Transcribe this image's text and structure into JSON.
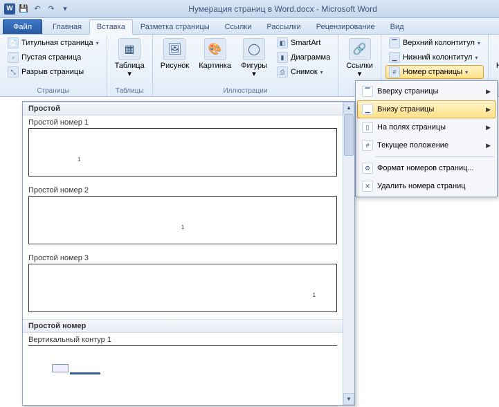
{
  "title": "Нумерация страниц в Word.docx - Microsoft Word",
  "qat": {
    "save": "💾",
    "undo": "↶",
    "redo": "↷"
  },
  "tabs": {
    "file": "Файл",
    "items": [
      "Главная",
      "Вставка",
      "Разметка страницы",
      "Ссылки",
      "Рассылки",
      "Рецензирование",
      "Вид"
    ],
    "active_index": 1
  },
  "ribbon": {
    "pages": {
      "title_page": "Титульная страница",
      "blank_page": "Пустая страница",
      "page_break": "Разрыв страницы",
      "group": "Страницы"
    },
    "tables": {
      "table": "Таблица",
      "group": "Таблицы"
    },
    "illus": {
      "picture": "Рисунок",
      "clipart": "Картинка",
      "shapes": "Фигуры",
      "smartart": "SmartArt",
      "chart": "Диаграмма",
      "screenshot": "Снимок",
      "group": "Иллюстрации"
    },
    "links": {
      "links": "Ссылки",
      "group": ""
    },
    "headerfooter": {
      "header": "Верхний колонтитул",
      "footer": "Нижний колонтитул",
      "page_number": "Номер страницы",
      "group": ""
    },
    "text": {
      "textbox": "Надпись"
    }
  },
  "menu": {
    "top": "Вверху страницы",
    "bottom": "Внизу страницы",
    "margins": "На полях страницы",
    "current": "Текущее положение",
    "format": "Формат номеров страниц...",
    "remove": "Удалить номера страниц"
  },
  "gallery": {
    "cat1": "Простой",
    "item1": "Простой номер 1",
    "item2": "Простой номер 2",
    "item3": "Простой номер 3",
    "cat2": "Простой номер",
    "item4": "Вертикальный контур 1",
    "page_sample": "1"
  }
}
